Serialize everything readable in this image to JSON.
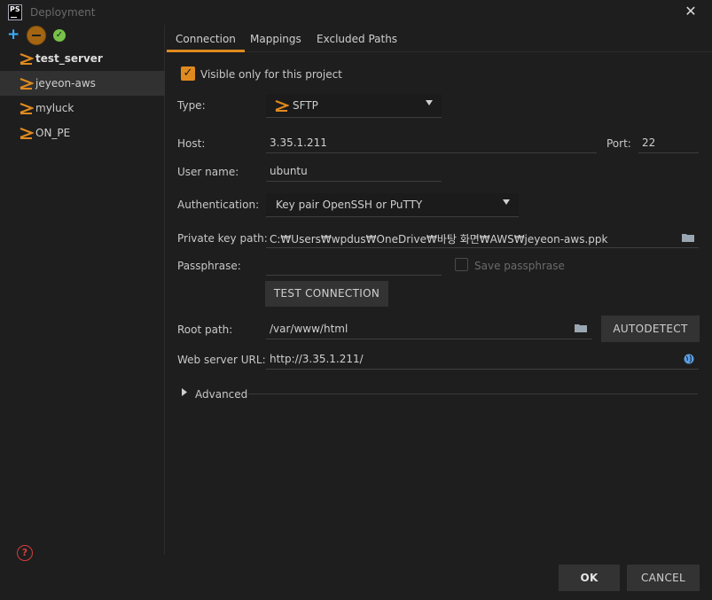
{
  "window": {
    "title": "Deployment",
    "logo_text": "PS",
    "close_glyph": "✕"
  },
  "toolbar": {
    "add_glyph": "+",
    "default_glyph": "✓"
  },
  "servers": [
    {
      "label": "test_server",
      "bold": true,
      "selected": false
    },
    {
      "label": "jeyeon-aws",
      "bold": false,
      "selected": true
    },
    {
      "label": "myluck",
      "bold": false,
      "selected": false
    },
    {
      "label": "ON_PE",
      "bold": false,
      "selected": false
    }
  ],
  "tabs": [
    {
      "label": "Connection",
      "active": true
    },
    {
      "label": "Mappings",
      "active": false
    },
    {
      "label": "Excluded Paths",
      "active": false
    }
  ],
  "form": {
    "visible_only_label": "Visible only for this project",
    "visible_only_checked": true,
    "type_label": "Type:",
    "type_value": "SFTP",
    "host_label": "Host:",
    "host_value": "3.35.1.211",
    "port_label": "Port:",
    "port_value": "22",
    "username_label": "User name:",
    "username_value": "ubuntu",
    "auth_label": "Authentication:",
    "auth_value": "Key pair OpenSSH or PuTTY",
    "keypath_label": "Private key path:",
    "keypath_value": "C:₩Users₩wpdus₩OneDrive₩바탕 화면₩AWS₩jeyeon-aws.ppk",
    "passphrase_label": "Passphrase:",
    "passphrase_value": "",
    "save_passphrase_label": "Save passphrase",
    "test_connection_label": "TEST CONNECTION",
    "rootpath_label": "Root path:",
    "rootpath_value": "/var/www/html",
    "autodetect_label": "AUTODETECT",
    "weburl_label": "Web server URL:",
    "weburl_value": "http://3.35.1.211/",
    "advanced_label": "Advanced"
  },
  "footer": {
    "help_glyph": "?",
    "ok_label": "OK",
    "cancel_label": "CANCEL"
  },
  "colors": {
    "accent": "#e08a1e",
    "background": "#1e1e1e",
    "selected_row": "#313131",
    "button": "#333333"
  }
}
